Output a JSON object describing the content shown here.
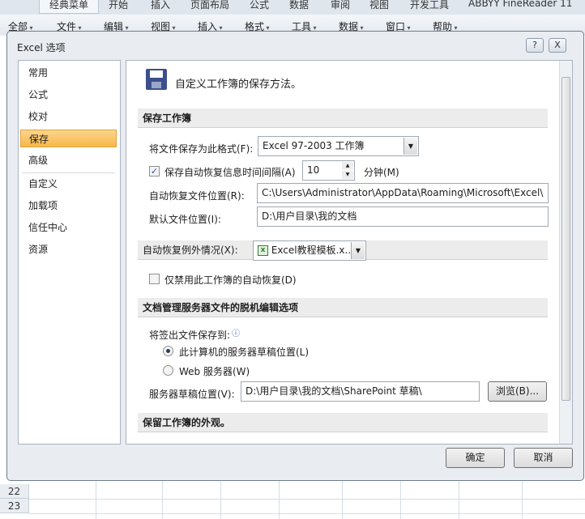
{
  "ribbon": {
    "tabs": [
      "经典菜单",
      "开始",
      "插入",
      "页面布局",
      "公式",
      "数据",
      "审阅",
      "视图",
      "开发工具",
      "ABBYY FineReader 11"
    ]
  },
  "menu": {
    "items": [
      "全部",
      "文件",
      "编辑",
      "视图",
      "插入",
      "格式",
      "工具",
      "数据",
      "窗口",
      "帮助"
    ]
  },
  "grid": {
    "rows": [
      "22",
      "23"
    ]
  },
  "dialog": {
    "title": "Excel 选项",
    "help": "?",
    "close": "X",
    "nav": [
      "常用",
      "公式",
      "校对",
      "保存",
      "高级",
      "自定义",
      "加载项",
      "信任中心",
      "资源"
    ],
    "header": "自定义工作簿的保存方法。",
    "sec1": {
      "title": "保存工作簿",
      "format_label": "将文件保存为此格式(F):",
      "format_value": "Excel 97-2003 工作簿",
      "autosave_label": "保存自动恢复信息时间间隔(A)",
      "autosave_checked": true,
      "autosave_value": "10",
      "minutes": "分钟(M)",
      "recover_label": "自动恢复文件位置(R):",
      "recover_value": "C:\\Users\\Administrator\\AppData\\Roaming\\Microsoft\\Excel\\",
      "default_label": "默认文件位置(I):",
      "default_value": "D:\\用户目录\\我的文档"
    },
    "sec2": {
      "title": "自动恢复例外情况(X):",
      "workbook": "Excel教程模板.x...",
      "disable_label": "仅禁用此工作簿的自动恢复(D)",
      "disable_checked": false
    },
    "sec3": {
      "title": "文档管理服务器文件的脱机编辑选项",
      "checkout_label": "将签出文件保存到:",
      "opt1": "此计算机的服务器草稿位置(L)",
      "opt2": "Web 服务器(W)",
      "selected": "opt1",
      "drafts_label": "服务器草稿位置(V):",
      "drafts_value": "D:\\用户目录\\我的文档\\SharePoint 草稿\\",
      "browse": "浏览(B)..."
    },
    "sec4": {
      "title": "保留工作簿的外观。"
    },
    "ok": "确定",
    "cancel": "取消"
  }
}
